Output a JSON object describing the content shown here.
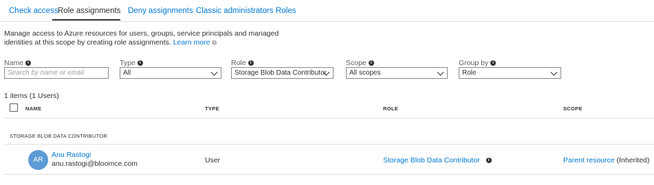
{
  "tabs": [
    {
      "label": "Check access"
    },
    {
      "label": "Role assignments"
    },
    {
      "label": "Deny assignments"
    },
    {
      "label": "Classic administrators"
    },
    {
      "label": "Roles"
    }
  ],
  "description": {
    "text": "Manage access to Azure resources for users, groups, service principals and managed identities at this scope by creating role assignments.",
    "link": "Learn more"
  },
  "filters": {
    "name": {
      "label": "Name",
      "placeholder": "Search by name or email"
    },
    "type": {
      "label": "Type",
      "value": "All"
    },
    "role": {
      "label": "Role",
      "value": "Storage Blob Data Contributor"
    },
    "scope": {
      "label": "Scope",
      "value": "All scopes"
    },
    "group_by": {
      "label": "Group by",
      "value": "Role"
    }
  },
  "count_text": "1 items (1 Users)",
  "columns": {
    "name": "NAME",
    "type": "TYPE",
    "role": "ROLE",
    "scope": "SCOPE"
  },
  "group_header": "STORAGE BLOB DATA CONTRIBUTOR",
  "rows": [
    {
      "initials": "AR",
      "name": "Anu Rastogi",
      "email": "anu.rastogi@bloomce.com",
      "type": "User",
      "role": "Storage Blob Data Contributor",
      "scope_link": "Parent resource",
      "scope_suffix": "(Inherited)"
    }
  ],
  "colors": {
    "accent": "#0078d4",
    "avatar": "#5c9bd5",
    "text": "#323130"
  }
}
